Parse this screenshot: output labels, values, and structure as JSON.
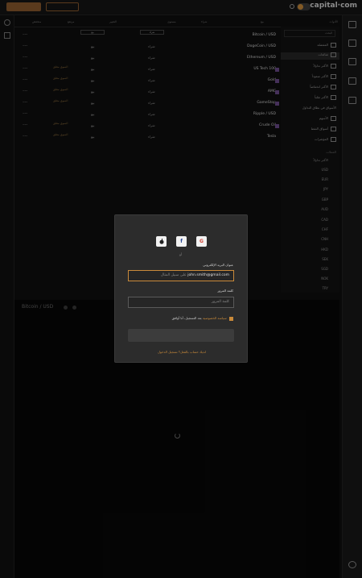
{
  "topbar": {
    "logo": "capital·com",
    "btn_primary": "",
    "btn_secondary": ""
  },
  "header": [
    "الأدوات",
    "بيع",
    "شراء",
    "مستوى",
    "التغيير",
    "مرتفع",
    "منخفض"
  ],
  "sidebar": {
    "search_placeholder": "البحث",
    "items": [
      {
        "label": "المفضلة"
      },
      {
        "label": "شائعات"
      },
      {
        "label": "الأكثر تداولاً"
      },
      {
        "label": "الأكثر صعوداً"
      },
      {
        "label": "الأكثر انخفاضاً"
      },
      {
        "label": "الأكثر تقلباً"
      },
      {
        "label": "الأسواق في نطاق التداول"
      },
      {
        "label": "الأسهم"
      },
      {
        "label": "أسواق النفط"
      },
      {
        "label": "المؤشرات"
      }
    ],
    "section": "العملات",
    "sub_top": "الأكثر تداولاً",
    "currencies": [
      "USD",
      "EUR",
      "JPY",
      "GBP",
      "AUD",
      "CAD",
      "CHF",
      "CNH",
      "HKD",
      "SEK",
      "SGD",
      "NOK",
      "TRY"
    ]
  },
  "rows": [
    {
      "name": "Bitcoin / USD",
      "buy": "شراء",
      "sell": "بيع",
      "tag": ""
    },
    {
      "name": "DogeCoin / USD",
      "buy": "شراء",
      "sell": "بيع",
      "tag": ""
    },
    {
      "name": "Ethereum / USD",
      "buy": "شراء",
      "sell": "بيع",
      "tag": ""
    },
    {
      "name": "US Tech 100",
      "buy": "شراء",
      "sell": "بيع",
      "tag": "السوق مغلق"
    },
    {
      "name": "Gold",
      "buy": "شراء",
      "sell": "بيع",
      "tag": "السوق مغلق"
    },
    {
      "name": "AMC",
      "buy": "شراء",
      "sell": "بيع",
      "tag": "السوق مغلق"
    },
    {
      "name": "GameStop",
      "buy": "شراء",
      "sell": "بيع",
      "tag": "السوق مغلق"
    },
    {
      "name": "Ripple / USD",
      "buy": "شراء",
      "sell": "بيع",
      "tag": ""
    },
    {
      "name": "Crude Oil",
      "buy": "شراء",
      "sell": "بيع",
      "tag": "السوق مغلق"
    },
    {
      "name": "Tesla",
      "buy": "شراء",
      "sell": "بيع",
      "tag": "السوق مغلق"
    }
  ],
  "chart": {
    "title": "Bitcoin / USD"
  },
  "modal": {
    "sso": {
      "apple": "",
      "facebook": "f",
      "google": "G"
    },
    "or": "أو",
    "email_label": "عنوان البريد الإلكتروني",
    "email_prefix": "على سبيل المثال",
    "email_value": "john.smith@gmail.com",
    "password_label": "كلمة المرور",
    "password_placeholder": "كلمة المرور",
    "consent_text": "بعد التسجيل، أنا أوافق",
    "consent_link": "سياسة الخصوصية",
    "footer": "لديك حساب بالفعل؟ تسجيل الدخول"
  }
}
